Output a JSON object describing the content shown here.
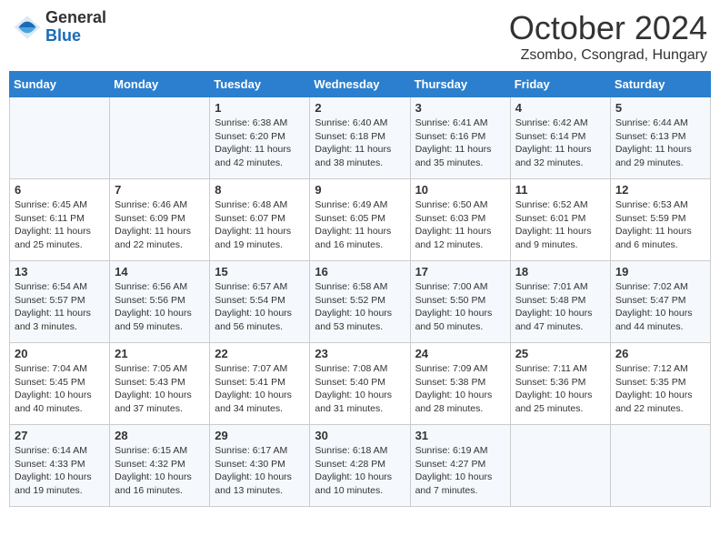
{
  "header": {
    "logo_general": "General",
    "logo_blue": "Blue",
    "month_title": "October 2024",
    "location": "Zsombo, Csongrad, Hungary"
  },
  "days_of_week": [
    "Sunday",
    "Monday",
    "Tuesday",
    "Wednesday",
    "Thursday",
    "Friday",
    "Saturday"
  ],
  "weeks": [
    [
      {
        "day": "",
        "sunrise": "",
        "sunset": "",
        "daylight": ""
      },
      {
        "day": "",
        "sunrise": "",
        "sunset": "",
        "daylight": ""
      },
      {
        "day": "1",
        "sunrise": "Sunrise: 6:38 AM",
        "sunset": "Sunset: 6:20 PM",
        "daylight": "Daylight: 11 hours and 42 minutes."
      },
      {
        "day": "2",
        "sunrise": "Sunrise: 6:40 AM",
        "sunset": "Sunset: 6:18 PM",
        "daylight": "Daylight: 11 hours and 38 minutes."
      },
      {
        "day": "3",
        "sunrise": "Sunrise: 6:41 AM",
        "sunset": "Sunset: 6:16 PM",
        "daylight": "Daylight: 11 hours and 35 minutes."
      },
      {
        "day": "4",
        "sunrise": "Sunrise: 6:42 AM",
        "sunset": "Sunset: 6:14 PM",
        "daylight": "Daylight: 11 hours and 32 minutes."
      },
      {
        "day": "5",
        "sunrise": "Sunrise: 6:44 AM",
        "sunset": "Sunset: 6:13 PM",
        "daylight": "Daylight: 11 hours and 29 minutes."
      }
    ],
    [
      {
        "day": "6",
        "sunrise": "Sunrise: 6:45 AM",
        "sunset": "Sunset: 6:11 PM",
        "daylight": "Daylight: 11 hours and 25 minutes."
      },
      {
        "day": "7",
        "sunrise": "Sunrise: 6:46 AM",
        "sunset": "Sunset: 6:09 PM",
        "daylight": "Daylight: 11 hours and 22 minutes."
      },
      {
        "day": "8",
        "sunrise": "Sunrise: 6:48 AM",
        "sunset": "Sunset: 6:07 PM",
        "daylight": "Daylight: 11 hours and 19 minutes."
      },
      {
        "day": "9",
        "sunrise": "Sunrise: 6:49 AM",
        "sunset": "Sunset: 6:05 PM",
        "daylight": "Daylight: 11 hours and 16 minutes."
      },
      {
        "day": "10",
        "sunrise": "Sunrise: 6:50 AM",
        "sunset": "Sunset: 6:03 PM",
        "daylight": "Daylight: 11 hours and 12 minutes."
      },
      {
        "day": "11",
        "sunrise": "Sunrise: 6:52 AM",
        "sunset": "Sunset: 6:01 PM",
        "daylight": "Daylight: 11 hours and 9 minutes."
      },
      {
        "day": "12",
        "sunrise": "Sunrise: 6:53 AM",
        "sunset": "Sunset: 5:59 PM",
        "daylight": "Daylight: 11 hours and 6 minutes."
      }
    ],
    [
      {
        "day": "13",
        "sunrise": "Sunrise: 6:54 AM",
        "sunset": "Sunset: 5:57 PM",
        "daylight": "Daylight: 11 hours and 3 minutes."
      },
      {
        "day": "14",
        "sunrise": "Sunrise: 6:56 AM",
        "sunset": "Sunset: 5:56 PM",
        "daylight": "Daylight: 10 hours and 59 minutes."
      },
      {
        "day": "15",
        "sunrise": "Sunrise: 6:57 AM",
        "sunset": "Sunset: 5:54 PM",
        "daylight": "Daylight: 10 hours and 56 minutes."
      },
      {
        "day": "16",
        "sunrise": "Sunrise: 6:58 AM",
        "sunset": "Sunset: 5:52 PM",
        "daylight": "Daylight: 10 hours and 53 minutes."
      },
      {
        "day": "17",
        "sunrise": "Sunrise: 7:00 AM",
        "sunset": "Sunset: 5:50 PM",
        "daylight": "Daylight: 10 hours and 50 minutes."
      },
      {
        "day": "18",
        "sunrise": "Sunrise: 7:01 AM",
        "sunset": "Sunset: 5:48 PM",
        "daylight": "Daylight: 10 hours and 47 minutes."
      },
      {
        "day": "19",
        "sunrise": "Sunrise: 7:02 AM",
        "sunset": "Sunset: 5:47 PM",
        "daylight": "Daylight: 10 hours and 44 minutes."
      }
    ],
    [
      {
        "day": "20",
        "sunrise": "Sunrise: 7:04 AM",
        "sunset": "Sunset: 5:45 PM",
        "daylight": "Daylight: 10 hours and 40 minutes."
      },
      {
        "day": "21",
        "sunrise": "Sunrise: 7:05 AM",
        "sunset": "Sunset: 5:43 PM",
        "daylight": "Daylight: 10 hours and 37 minutes."
      },
      {
        "day": "22",
        "sunrise": "Sunrise: 7:07 AM",
        "sunset": "Sunset: 5:41 PM",
        "daylight": "Daylight: 10 hours and 34 minutes."
      },
      {
        "day": "23",
        "sunrise": "Sunrise: 7:08 AM",
        "sunset": "Sunset: 5:40 PM",
        "daylight": "Daylight: 10 hours and 31 minutes."
      },
      {
        "day": "24",
        "sunrise": "Sunrise: 7:09 AM",
        "sunset": "Sunset: 5:38 PM",
        "daylight": "Daylight: 10 hours and 28 minutes."
      },
      {
        "day": "25",
        "sunrise": "Sunrise: 7:11 AM",
        "sunset": "Sunset: 5:36 PM",
        "daylight": "Daylight: 10 hours and 25 minutes."
      },
      {
        "day": "26",
        "sunrise": "Sunrise: 7:12 AM",
        "sunset": "Sunset: 5:35 PM",
        "daylight": "Daylight: 10 hours and 22 minutes."
      }
    ],
    [
      {
        "day": "27",
        "sunrise": "Sunrise: 6:14 AM",
        "sunset": "Sunset: 4:33 PM",
        "daylight": "Daylight: 10 hours and 19 minutes."
      },
      {
        "day": "28",
        "sunrise": "Sunrise: 6:15 AM",
        "sunset": "Sunset: 4:32 PM",
        "daylight": "Daylight: 10 hours and 16 minutes."
      },
      {
        "day": "29",
        "sunrise": "Sunrise: 6:17 AM",
        "sunset": "Sunset: 4:30 PM",
        "daylight": "Daylight: 10 hours and 13 minutes."
      },
      {
        "day": "30",
        "sunrise": "Sunrise: 6:18 AM",
        "sunset": "Sunset: 4:28 PM",
        "daylight": "Daylight: 10 hours and 10 minutes."
      },
      {
        "day": "31",
        "sunrise": "Sunrise: 6:19 AM",
        "sunset": "Sunset: 4:27 PM",
        "daylight": "Daylight: 10 hours and 7 minutes."
      },
      {
        "day": "",
        "sunrise": "",
        "sunset": "",
        "daylight": ""
      },
      {
        "day": "",
        "sunrise": "",
        "sunset": "",
        "daylight": ""
      }
    ]
  ]
}
